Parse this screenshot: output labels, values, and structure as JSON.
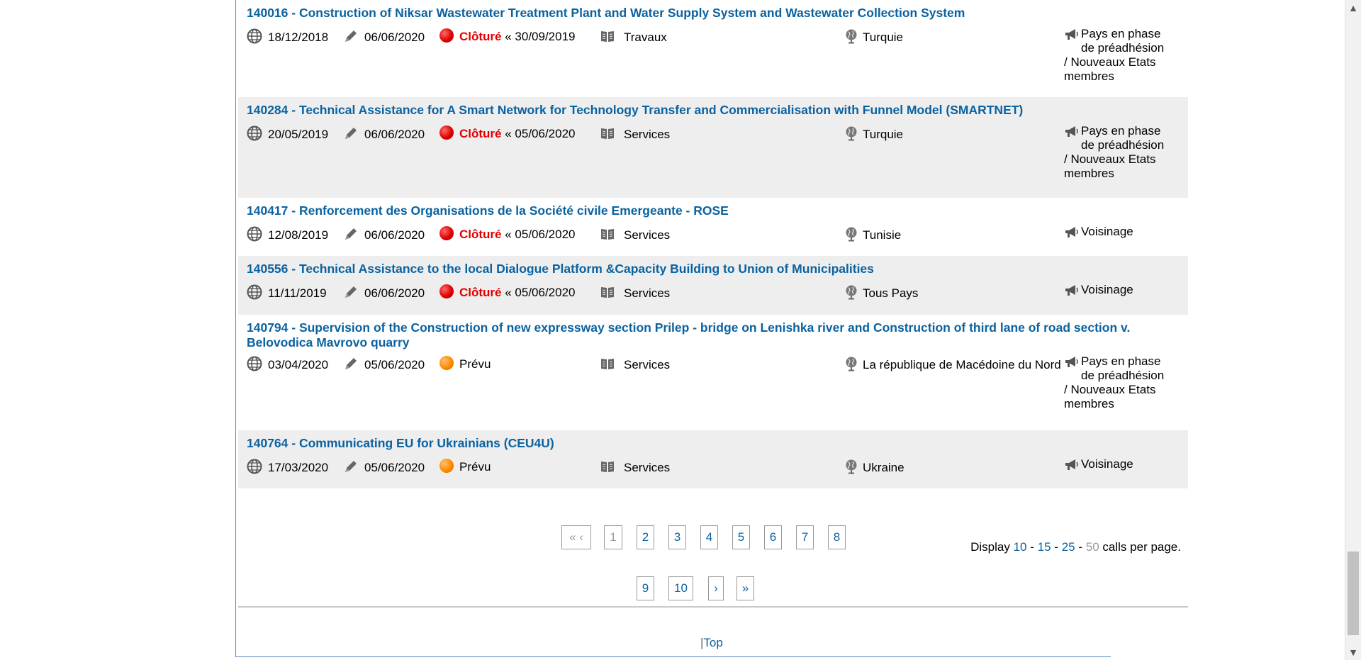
{
  "rows": [
    {
      "title": "140016 - Construction of Niksar Wastewater Treatment Plant and Water Supply System and Wastewater Collection System",
      "published": "18/12/2018",
      "updated": "06/06/2020",
      "status": "Clôturé",
      "status_color": "red",
      "deadline": "« 30/09/2019",
      "type": "Travaux",
      "country": "Turquie",
      "programme": "Pays en phase de préadhésion / Nouveaux Etats membres"
    },
    {
      "title": "140284 - Technical Assistance for A Smart Network for Technology Transfer and Commercialisation with Funnel Model (SMARTNET)",
      "published": "20/05/2019",
      "updated": "06/06/2020",
      "status": "Clôturé",
      "status_color": "red",
      "deadline": "« 05/06/2020",
      "type": "Services",
      "country": "Turquie",
      "programme": "Pays en phase de préadhésion / Nouveaux Etats membres"
    },
    {
      "title": "140417 - Renforcement des Organisations de la Société civile Emergeante - ROSE",
      "published": "12/08/2019",
      "updated": "06/06/2020",
      "status": "Clôturé",
      "status_color": "red",
      "deadline": "« 05/06/2020",
      "type": "Services",
      "country": "Tunisie",
      "programme": "Voisinage"
    },
    {
      "title": "140556 - Technical Assistance to the local Dialogue Platform &Capacity Building to Union of Municipalities",
      "published": "11/11/2019",
      "updated": "06/06/2020",
      "status": "Clôturé",
      "status_color": "red",
      "deadline": "« 05/06/2020",
      "type": "Services",
      "country": "Tous Pays",
      "programme": "Voisinage"
    },
    {
      "title": "140794 - Supervision of the Construction of new expressway section Prilep - bridge on Lenishka river and Construction of third lane of road section v. Belovodica  Mavrovo quarry",
      "published": "03/04/2020",
      "updated": "05/06/2020",
      "status": "Prévu",
      "status_color": "orange",
      "deadline": "",
      "type": "Services",
      "country": "La république de Macédoine du Nord",
      "programme": "Pays en phase de préadhésion / Nouveaux Etats membres"
    },
    {
      "title": "140764 - Communicating EU for Ukrainians (CEU4U)",
      "published": "17/03/2020",
      "updated": "05/06/2020",
      "status": "Prévu",
      "status_color": "orange",
      "deadline": "",
      "type": "Services",
      "country": "Ukraine",
      "programme": "Voisinage"
    }
  ],
  "pagination": {
    "first_prev": "« ‹",
    "pages": [
      "1",
      "2",
      "3",
      "4",
      "5",
      "6",
      "7",
      "8",
      "9",
      "10"
    ],
    "next": "›",
    "last": "»"
  },
  "per_page": {
    "prefix": "Display",
    "options": [
      "10",
      "15",
      "25",
      "50"
    ],
    "separator": "-",
    "current": "50",
    "suffix": "calls per page."
  },
  "footer": {
    "sep": "|",
    "top_link": "Top"
  }
}
